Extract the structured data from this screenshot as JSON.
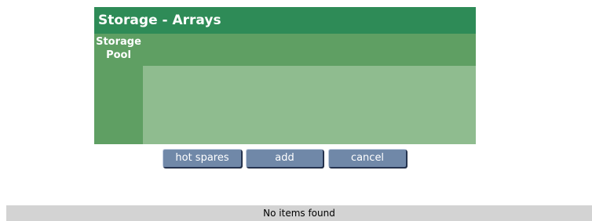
{
  "panel": {
    "title": "Storage - Arrays",
    "column_header": "Storage\nPool"
  },
  "buttons": {
    "hot_spares": "hot spares",
    "add": "add",
    "cancel": "cancel"
  },
  "status": {
    "message": "No items found"
  },
  "colors": {
    "title_bar": "#2e8b57",
    "header": "#5f9f63",
    "body": "#8fbc8f",
    "button": "#7088a8",
    "status_bar": "#d3d3d3"
  }
}
